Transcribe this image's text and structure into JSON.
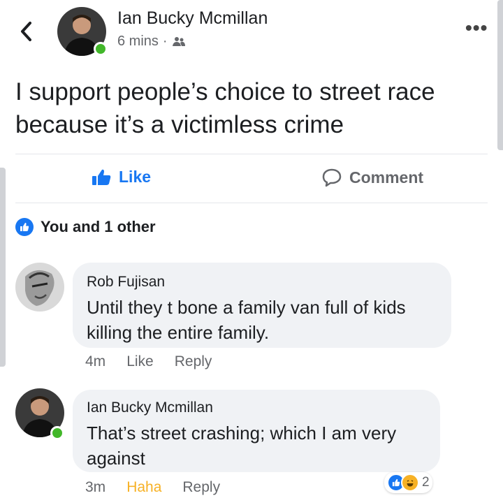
{
  "post": {
    "author": "Ian Bucky Mcmillan",
    "time": "6 mins",
    "separator": "·",
    "text": "I support people’s choice to street race because it’s a victimless crime"
  },
  "actions": {
    "like": "Like",
    "comment": "Comment"
  },
  "reactions": {
    "summary": "You and 1 other"
  },
  "comments": [
    {
      "name": "Rob Fujisan",
      "text": "Until they t bone a family van full of kids killing the entire family.",
      "time": "4m",
      "like": "Like",
      "reply": "Reply"
    },
    {
      "name": "Ian Bucky Mcmillan",
      "text": "That’s street crashing; which I am very against",
      "time": "3m",
      "reaction": "Haha",
      "reply": "Reply",
      "reaction_count": "2"
    }
  ],
  "colors": {
    "accent": "#1877f2",
    "online": "#42b72a",
    "haha": "#f7b125"
  },
  "icons": [
    "back-chevron-icon",
    "friends-audience-icon",
    "more-options-icon",
    "like-thumb-icon",
    "comment-bubble-icon",
    "haha-emoji-icon"
  ]
}
